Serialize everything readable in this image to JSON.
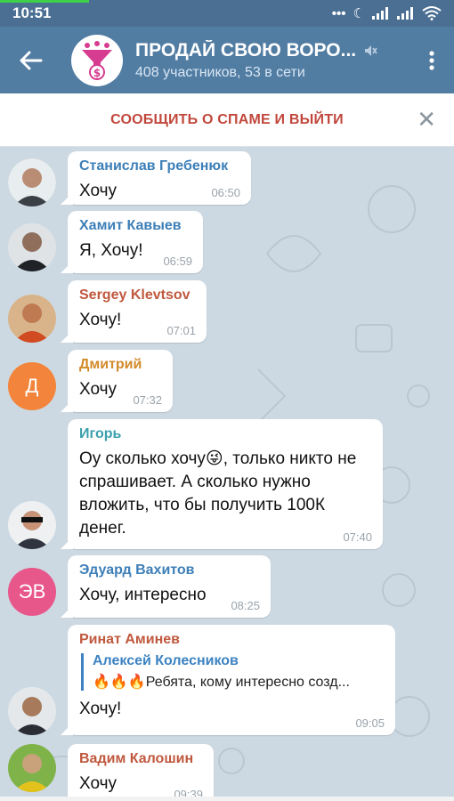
{
  "status_bar": {
    "time": "10:51",
    "icons": [
      "dots-icon",
      "moon-icon",
      "signal-icon",
      "signal-icon",
      "wifi-icon"
    ]
  },
  "header": {
    "title": "ПРОДАЙ СВОЮ ВОРО...",
    "subtitle": "408 участников, 53 в сети",
    "accent": "#527da3"
  },
  "spam_bar": {
    "label": "СООБЩИТЬ О СПАМЕ И ВЫЙТИ",
    "color": "#c1473c"
  },
  "messages": [
    {
      "sender": "Станислав Гребенюк",
      "sender_color": "#3d7fb8",
      "text": "Хочу",
      "time": "06:50",
      "avatar": "photo"
    },
    {
      "sender": "Хамит Кавыев",
      "sender_color": "#3d7fb8",
      "text": "Я, Хочу!",
      "time": "06:59",
      "avatar": "photo"
    },
    {
      "sender": "Sergey Klevtsov",
      "sender_color": "#c0583e",
      "text": "Хочу!",
      "time": "07:01",
      "avatar": "photo"
    },
    {
      "sender": "Дмитрий",
      "sender_color": "#d28a2a",
      "text": "Хочу",
      "time": "07:32",
      "avatar_initials": "Д",
      "avatar_color": "#f2853b"
    },
    {
      "sender": "Игорь",
      "sender_color": "#3aa0ad",
      "text": "Оу сколько хочу😜, только никто не спрашивает. А сколько нужно вложить, что бы получить 100К денег.",
      "time": "07:40",
      "avatar": "photo"
    },
    {
      "sender": "Эдуард Вахитов",
      "sender_color": "#3d7fb8",
      "text": "Хочу, интересно",
      "time": "08:25",
      "avatar_initials": "ЭВ",
      "avatar_color": "#e8578a"
    },
    {
      "sender": "Ринат Аминев",
      "sender_color": "#c0583e",
      "reply_name": "Алексей Колесников",
      "reply_text": "🔥🔥🔥Ребята, кому интересно созд...",
      "text": "Хочу!",
      "time": "09:05",
      "avatar": "photo"
    },
    {
      "sender": "Вадим Калошин",
      "sender_color": "#c0583e",
      "text": "Хочу",
      "time": "09:39",
      "avatar": "photo"
    }
  ]
}
